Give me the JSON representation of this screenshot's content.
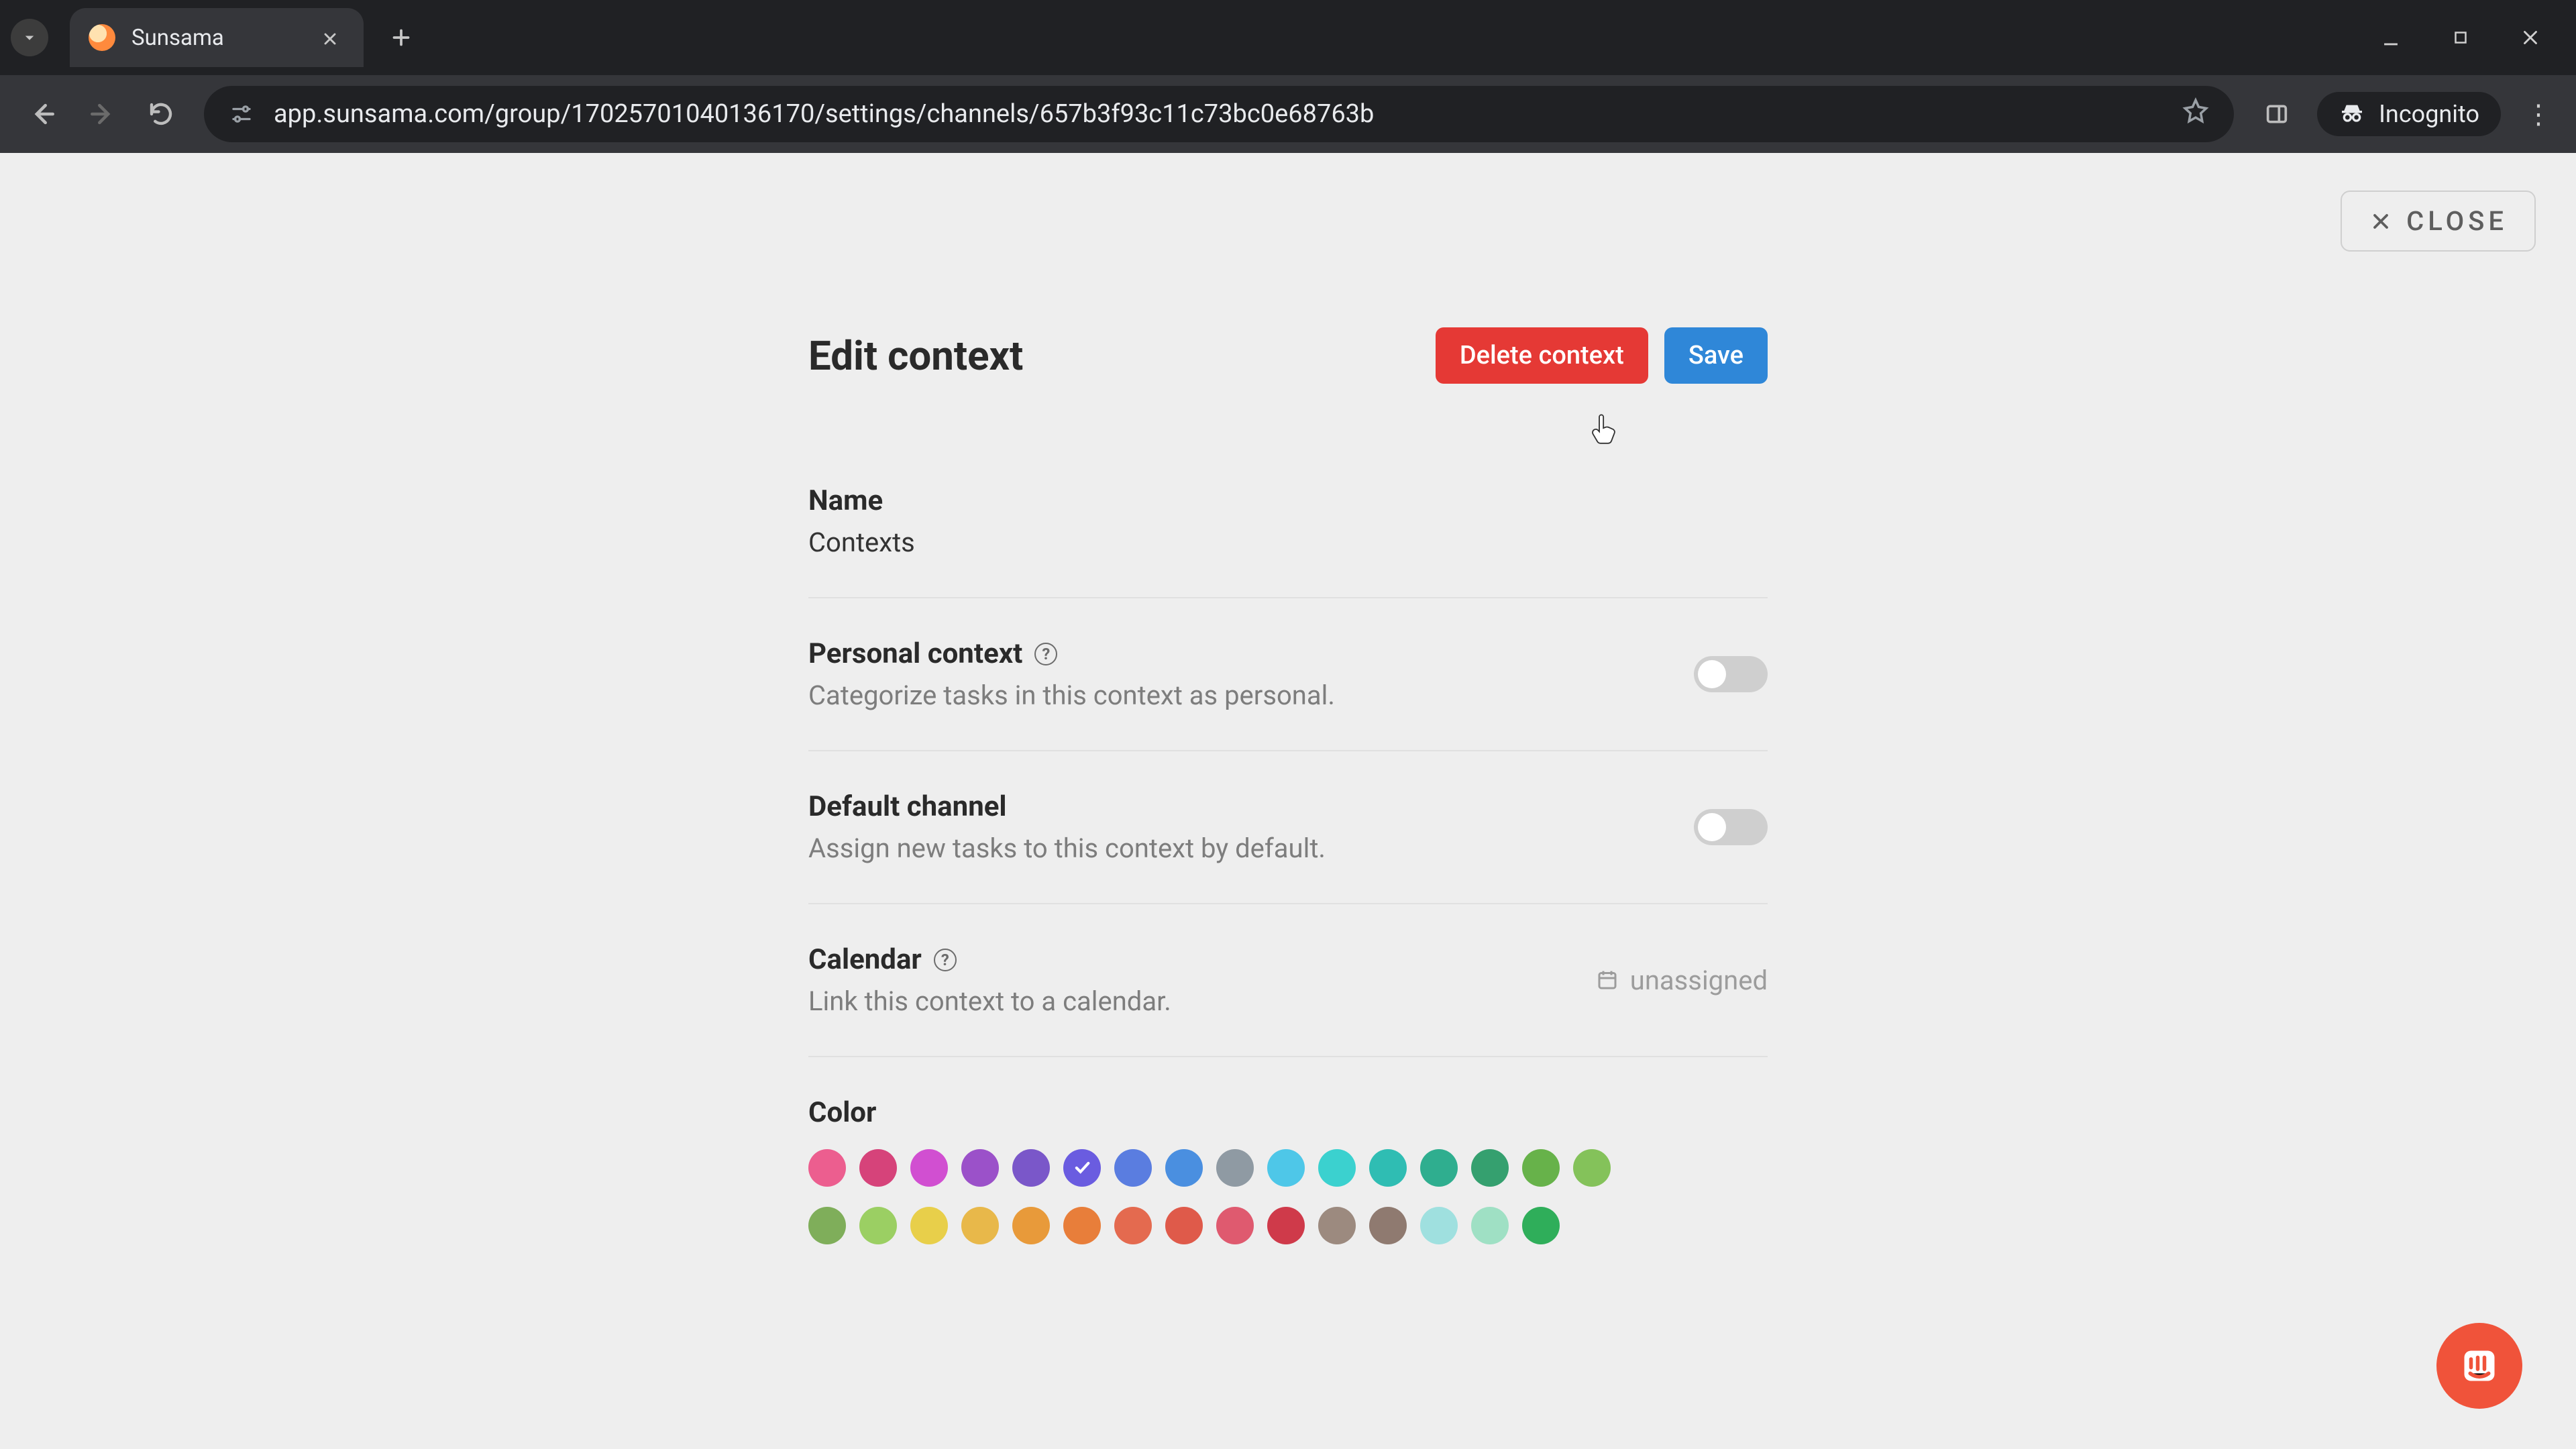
{
  "browser": {
    "tab_title": "Sunsama",
    "url": "app.sunsama.com/group/17025701040136170/settings/channels/657b3f93c11c73bc0e68763b",
    "incognito_label": "Incognito"
  },
  "header": {
    "close_label": "CLOSE"
  },
  "panel": {
    "title": "Edit context",
    "delete_label": "Delete context",
    "save_label": "Save"
  },
  "name": {
    "label": "Name",
    "value": "Contexts"
  },
  "personal": {
    "label": "Personal context",
    "desc": "Categorize tasks in this context as personal.",
    "enabled": false
  },
  "default_channel": {
    "label": "Default channel",
    "desc": "Assign new tasks to this context by default.",
    "enabled": false
  },
  "calendar": {
    "label": "Calendar",
    "desc": "Link this context to a calendar.",
    "value": "unassigned"
  },
  "color": {
    "label": "Color",
    "selected_index_row1": 5,
    "row1": [
      "#ec5e8f",
      "#d6437a",
      "#d14fd1",
      "#9b51c9",
      "#7a57c9",
      "#6a5ce0",
      "#5a7de0",
      "#4a8fe0",
      "#8f9aa3",
      "#4ec7e8",
      "#3bd1cf",
      "#2fbdb3",
      "#2fae8f",
      "#35a06f",
      "#67b24a",
      "#84c25a"
    ],
    "row2": [
      "#7fae5a",
      "#9bcf63",
      "#e8cf4a",
      "#e8b84a",
      "#e89a3a",
      "#e87e3a",
      "#e46a4f",
      "#df5a4a",
      "#df5a6f",
      "#cf3a4a",
      "#9c8a7f",
      "#8f7a70",
      "#9fe0df",
      "#9fe0c4",
      "#2fae5a"
    ]
  }
}
